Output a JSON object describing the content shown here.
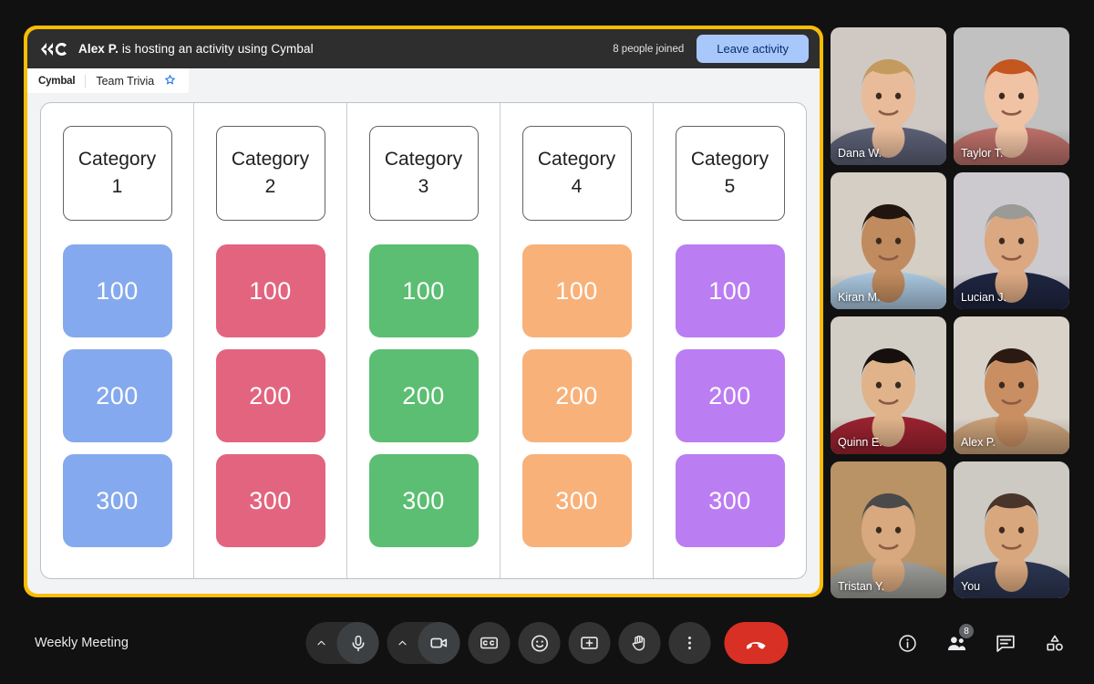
{
  "activity": {
    "logo_icon": "cymbal-logo-icon",
    "host_name": "Alex P.",
    "host_text_rest": " is hosting an activity using Cymbal",
    "joined_count_label": "8 people joined",
    "leave_label": "Leave activity",
    "docbar": {
      "brand": "Cymbal",
      "title": "Team Trivia",
      "star_icon": "star-icon",
      "star_glyph": "☆"
    },
    "frame_color": "#fbbc04",
    "board": {
      "columns": [
        {
          "category": "Category\n1",
          "color": "#85a9ee",
          "tiles": [
            "100",
            "200",
            "300"
          ]
        },
        {
          "category": "Category\n2",
          "color": "#e3647f",
          "tiles": [
            "100",
            "200",
            "300"
          ]
        },
        {
          "category": "Category\n3",
          "color": "#5bbe72",
          "tiles": [
            "100",
            "200",
            "300"
          ]
        },
        {
          "category": "Category\n4",
          "color": "#f8b179",
          "tiles": [
            "100",
            "200",
            "300"
          ]
        },
        {
          "category": "Category\n5",
          "color": "#bb7df2",
          "tiles": [
            "100",
            "200",
            "300"
          ]
        }
      ]
    }
  },
  "participants": [
    {
      "name": "Dana W.",
      "active": false,
      "bg": "#d9d2cb",
      "skin": "#e8bb9a",
      "hair": "#c49a5e",
      "shirt": "#5b5f74"
    },
    {
      "name": "Taylor T.",
      "active": false,
      "bg": "#c9c9c9",
      "skin": "#f0c3a4",
      "hair": "#c4561f",
      "shirt": "#bb6f68"
    },
    {
      "name": "Kiran M.",
      "active": false,
      "bg": "#ded7cd",
      "skin": "#c08b5e",
      "hair": "#20150f",
      "shirt": "#a8c5dd"
    },
    {
      "name": "Lucian J.",
      "active": false,
      "bg": "#d5d3d8",
      "skin": "#dba882",
      "hair": "#9a9a96",
      "shirt": "#1e2540"
    },
    {
      "name": "Quinn E.",
      "active": false,
      "bg": "#dcd7ce",
      "skin": "#e0b38a",
      "hair": "#15100d",
      "shirt": "#9b2230"
    },
    {
      "name": "Alex P.",
      "active": false,
      "bg": "#e2dbd2",
      "skin": "#c98f62",
      "hair": "#2a1a12",
      "shirt": "#c9a179"
    },
    {
      "name": "Tristan Y.",
      "active": false,
      "bg": "#c19a6b",
      "skin": "#d8a87e",
      "hair": "#4a4a4a",
      "shirt": "#9b9b98"
    },
    {
      "name": "You",
      "active": true,
      "bg": "#d6d2cb",
      "skin": "#d9a77e",
      "hair": "#4a352a",
      "shirt": "#2b3550"
    }
  ],
  "bottom_bar": {
    "meeting_name": "Weekly Meeting",
    "controls": [
      {
        "name": "mic-options-chevron",
        "icon": "chevron-up-icon"
      },
      {
        "name": "microphone-button",
        "icon": "microphone-icon"
      },
      {
        "name": "camera-options-chevron",
        "icon": "chevron-up-icon"
      },
      {
        "name": "camera-button",
        "icon": "video-camera-icon"
      },
      {
        "name": "captions-button",
        "icon": "closed-captions-icon"
      },
      {
        "name": "reactions-button",
        "icon": "emoji-smiley-icon"
      },
      {
        "name": "present-screen-button",
        "icon": "present-screen-icon"
      },
      {
        "name": "raise-hand-button",
        "icon": "raised-hand-icon"
      },
      {
        "name": "more-options-button",
        "icon": "three-dots-vertical-icon"
      },
      {
        "name": "end-call-button",
        "icon": "phone-hangup-icon"
      }
    ],
    "right_icons": [
      {
        "name": "meeting-details-button",
        "icon": "info-circle-icon",
        "badge": ""
      },
      {
        "name": "people-panel-button",
        "icon": "people-icon",
        "badge": "8"
      },
      {
        "name": "chat-panel-button",
        "icon": "chat-bubble-icon",
        "badge": ""
      },
      {
        "name": "activities-panel-button",
        "icon": "activities-shapes-icon",
        "badge": ""
      }
    ]
  },
  "colors": {
    "accent_yellow": "#fbbc04",
    "leave_button": "#a8c7fa",
    "end_call_red": "#d93025",
    "active_speaker_border": "#8ab4f8"
  }
}
